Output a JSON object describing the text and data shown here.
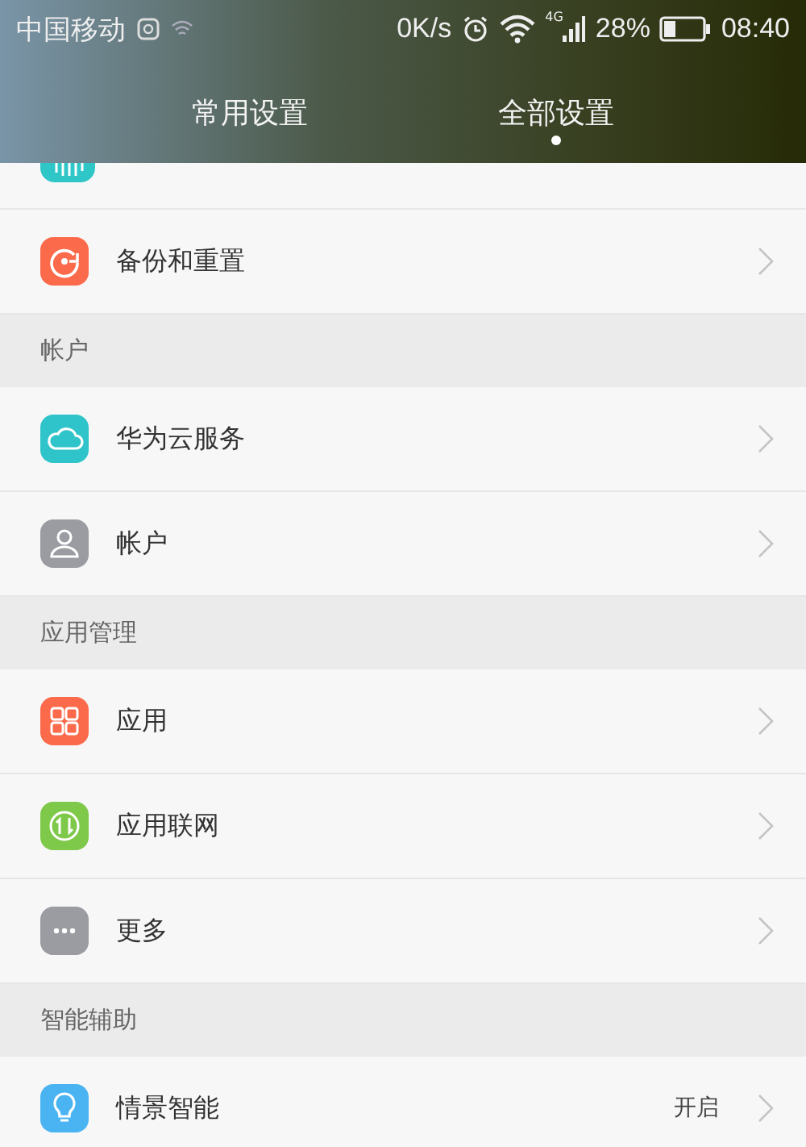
{
  "status_bar": {
    "carrier": "中国移动",
    "speed": "0K/s",
    "network": "4G",
    "battery": "28%",
    "time": "08:40"
  },
  "tabs": [
    {
      "label": "常用设置",
      "selected": false
    },
    {
      "label": "全部设置",
      "selected": true
    }
  ],
  "partial_item": {
    "color": "#2fc6c8"
  },
  "items": [
    {
      "kind": "row",
      "label": "备份和重置",
      "color": "#fb6a4a"
    },
    {
      "kind": "section",
      "label": "帐户"
    },
    {
      "kind": "row",
      "label": "华为云服务",
      "color": "#2fc4c9"
    },
    {
      "kind": "row",
      "label": "帐户",
      "color": "#9b9ca1"
    },
    {
      "kind": "section",
      "label": "应用管理"
    },
    {
      "kind": "row",
      "label": "应用",
      "color": "#fb6a4a"
    },
    {
      "kind": "row",
      "label": "应用联网",
      "color": "#7ec84a"
    },
    {
      "kind": "row",
      "label": "更多",
      "color": "#9b9ca1"
    },
    {
      "kind": "section",
      "label": "智能辅助"
    },
    {
      "kind": "row",
      "label": "情景智能",
      "color": "#4ab4f2",
      "value": "开启"
    }
  ]
}
